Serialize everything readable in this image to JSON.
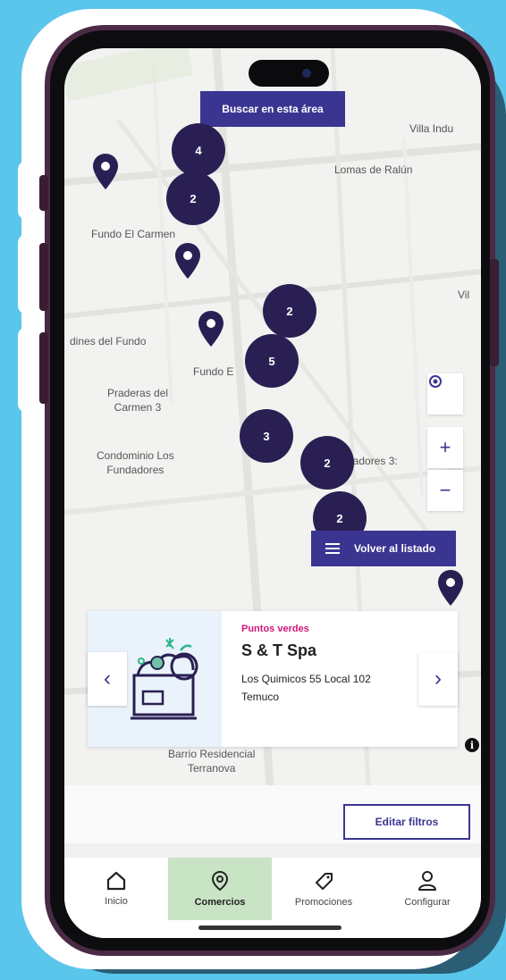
{
  "map": {
    "search_area_label": "Buscar en esta área",
    "labels": [
      "Villa Indu",
      "Lomas de Ralún",
      "Fundo El Carmen",
      "Vil",
      "dines del Fundo",
      "Fundo E",
      "Praderas del\nCarmen 3",
      "Condominio Los\nFundadores",
      "eadores 3:",
      "Barrio Residencial\nTerranova"
    ],
    "clusters": [
      "4",
      "2",
      "2",
      "5",
      "3",
      "2",
      "2"
    ],
    "controls": {
      "zoom_in": "+",
      "zoom_out": "−"
    },
    "back_to_list_label": "Volver al listado"
  },
  "card": {
    "category": "Puntos verdes",
    "name": "S & T Spa",
    "address_line1": "Los Quimicos 55 Local 102",
    "address_line2": "Temuco",
    "prev": "‹",
    "next": "›"
  },
  "info_icon": "i",
  "edit_filters_label": "Editar filtros",
  "tabs": [
    {
      "label": "Inicio",
      "icon": "home-icon"
    },
    {
      "label": "Comercios",
      "icon": "map-pin-icon",
      "active": true
    },
    {
      "label": "Promociones",
      "icon": "tag-icon"
    },
    {
      "label": "Configurar",
      "icon": "user-icon"
    }
  ],
  "colors": {
    "accent": "#3b3592",
    "cluster": "#2a1f52",
    "category": "#d0167c",
    "active_tab": "#c9e3c5",
    "background": "#5ac6ec"
  }
}
